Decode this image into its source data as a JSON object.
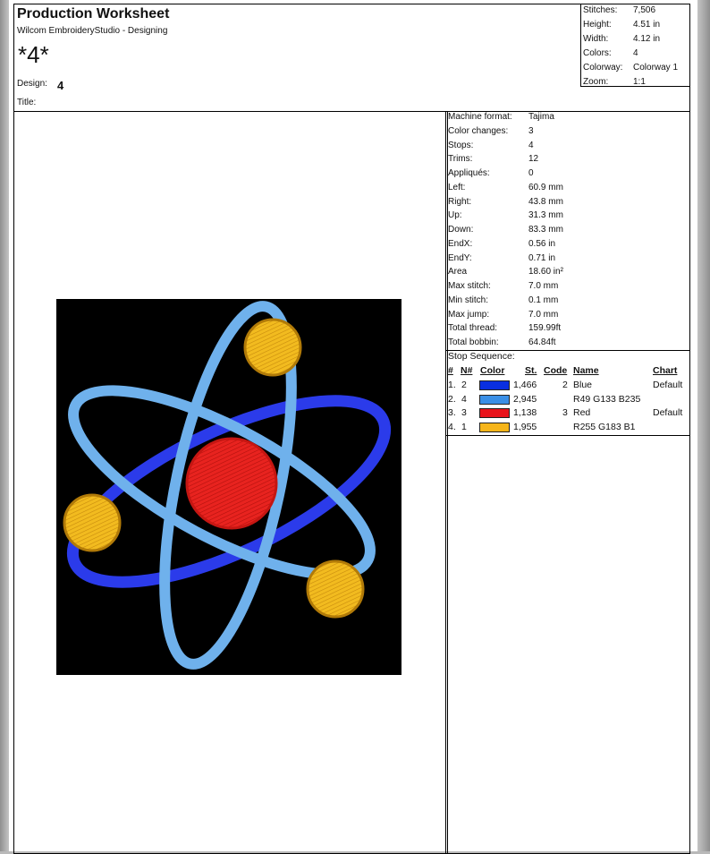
{
  "header": {
    "title": "Production Worksheet",
    "app": "Wilcom EmbroideryStudio - Designing",
    "design_big": "*4*",
    "design_label": "Design:",
    "design_value": "4",
    "title_label": "Title:"
  },
  "summary": [
    {
      "label": "Stitches:",
      "value": "7,506"
    },
    {
      "label": "Height:",
      "value": "4.51 in"
    },
    {
      "label": "Width:",
      "value": "4.12 in"
    },
    {
      "label": "Colors:",
      "value": "4"
    },
    {
      "label": "Colorway:",
      "value": "Colorway 1"
    },
    {
      "label": "Zoom:",
      "value": "1:1"
    }
  ],
  "stats": [
    {
      "label": "Machine format:",
      "value": "Tajima"
    },
    {
      "label": "Color changes:",
      "value": "3"
    },
    {
      "label": "Stops:",
      "value": "4"
    },
    {
      "label": "Trims:",
      "value": "12"
    },
    {
      "label": "Appliqués:",
      "value": "0"
    },
    {
      "label": "Left:",
      "value": "60.9 mm"
    },
    {
      "label": "Right:",
      "value": "43.8 mm"
    },
    {
      "label": "Up:",
      "value": "31.3 mm"
    },
    {
      "label": "Down:",
      "value": "83.3 mm"
    },
    {
      "label": "EndX:",
      "value": "0.56 in"
    },
    {
      "label": "EndY:",
      "value": "0.71 in"
    },
    {
      "label": "Area",
      "value": "18.60 in²"
    },
    {
      "label": "Max stitch:",
      "value": "7.0 mm"
    },
    {
      "label": "Min stitch:",
      "value": "0.1 mm"
    },
    {
      "label": "Max jump:",
      "value": "7.0 mm"
    },
    {
      "label": "Total thread:",
      "value": "159.99ft"
    },
    {
      "label": "Total bobbin:",
      "value": "64.84ft"
    }
  ],
  "stop_sequence": {
    "title": "Stop Sequence:",
    "headers": {
      "num": "#",
      "n": "N#",
      "color": "Color",
      "st": "St.",
      "code": "Code",
      "name": "Name",
      "chart": "Chart"
    },
    "rows": [
      {
        "num": "1.",
        "n": "2",
        "swatch": "#0a2fe0",
        "st": "1,466",
        "code": "2",
        "name": "Blue",
        "chart": "Default"
      },
      {
        "num": "2.",
        "n": "4",
        "swatch": "#3a8fe6",
        "st": "2,945",
        "code": "",
        "name": "R49 G133 B235",
        "chart": ""
      },
      {
        "num": "3.",
        "n": "3",
        "swatch": "#e8131b",
        "st": "1,138",
        "code": "3",
        "name": "Red",
        "chart": "Default"
      },
      {
        "num": "4.",
        "n": "1",
        "swatch": "#f6b51a",
        "st": "1,955",
        "code": "",
        "name": "R255 G183 B1",
        "chart": ""
      }
    ]
  },
  "design_colors": {
    "background": "#000000",
    "orbit_light": "#6fb1ec",
    "orbit_dark": "#2b3bea",
    "nucleus": "#e8231f",
    "electron": "#f2bb1f"
  }
}
